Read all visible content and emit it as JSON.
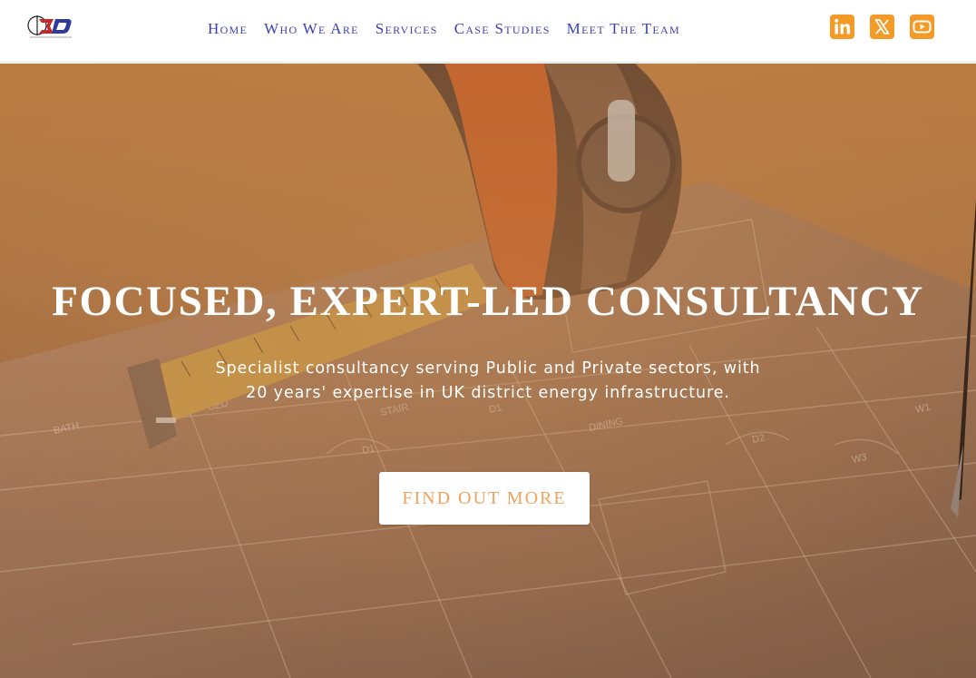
{
  "brand": {
    "logo_text": "3D",
    "logo_subtext": "TECHNICAL SERVICES"
  },
  "nav": [
    {
      "label": "Home"
    },
    {
      "label": "Who We Are"
    },
    {
      "label": "Services"
    },
    {
      "label": "Case Studies"
    },
    {
      "label": "Meet The Team"
    }
  ],
  "social": [
    {
      "icon": "linkedin-icon",
      "label": "LinkedIn"
    },
    {
      "icon": "x-icon",
      "label": "X"
    },
    {
      "icon": "youtube-icon",
      "label": "YouTube"
    }
  ],
  "hero": {
    "headline": "FOCUSED, EXPERT-LED CONSULTANCY",
    "subtext_line1": "Specialist consultancy serving Public and Private sectors, with",
    "subtext_line2": "20 years' expertise in UK district energy infrastructure.",
    "cta_label": "FIND OUT MORE",
    "background_image": "tape-measure-on-floor-plan-icon",
    "plan_labels": [
      "BATH",
      "BED",
      "STAIR",
      "DINING",
      "D1",
      "D2",
      "W1",
      "W3"
    ]
  },
  "colors": {
    "nav_text": "#3c3fb0",
    "social_bg": "#f39a27",
    "hero_overlay": "#c07836",
    "cta_text": "#f0a25f",
    "white": "#ffffff"
  }
}
